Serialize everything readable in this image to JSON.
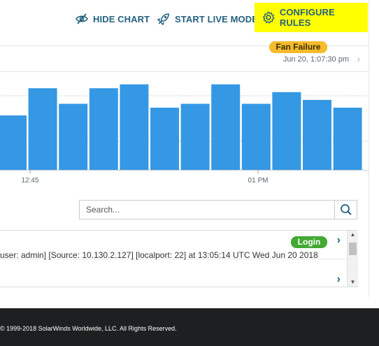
{
  "toolbar": {
    "hide_chart_label": "HIDE CHART",
    "live_mode_label": "START LIVE MODE",
    "configure_label": "CONFIGURE RULES",
    "highlight_color": "#ffff00",
    "accent_color": "#25607f"
  },
  "chart_header": {
    "timestamp": "Jun 20, 1:07:30 pm"
  },
  "chart_data": {
    "type": "bar",
    "series": [
      {
        "values": [
          14,
          21,
          17,
          21,
          22,
          16,
          17,
          22,
          17,
          20,
          18,
          16
        ]
      }
    ],
    "x_tick_labels": [
      "12:45",
      "01 PM"
    ],
    "ylim": [
      0,
      25
    ],
    "bar_color": "#3498e4",
    "grid": true
  },
  "search": {
    "placeholder": "Search..."
  },
  "events": [
    {
      "badge": "Login",
      "badge_color": "#43a933",
      "text": "user: admin] [Source: 10.130.2.127] [localport: 22] at 13:05:14 UTC Wed Jun 20 2018"
    },
    {
      "badge": "Fan Failure",
      "badge_color": "#f5bb2c",
      "text": ""
    }
  ],
  "footer": {
    "copyright": "© 1999-2018 SolarWinds Worldwide, LLC. All Rights Reserved."
  }
}
